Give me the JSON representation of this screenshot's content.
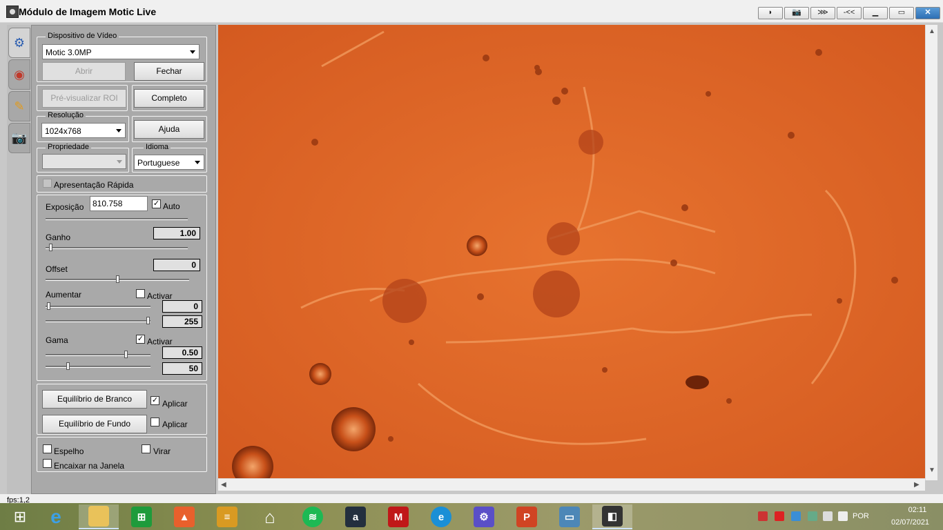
{
  "window": {
    "title": "Módulo de Imagem Motic Live",
    "controls": [
      "play",
      "camera",
      "fish",
      "rewind",
      "minimize",
      "maximize",
      "close"
    ]
  },
  "video_device": {
    "group_label": "Dispositivo de Vídeo",
    "selected": "Motic 3.0MP",
    "open_label": "Abrir",
    "close_label": "Fechar",
    "preview_roi_label": "Pré-visualizar ROI",
    "full_label": "Completo"
  },
  "resolution": {
    "group_label": "Resolução",
    "selected": "1024x768",
    "help_label": "Ajuda"
  },
  "property": {
    "group_label": "Propriedade",
    "selected": ""
  },
  "language": {
    "group_label": "Idioma",
    "selected": "Portuguese"
  },
  "quick_preview": {
    "label": "Apresentação Rápida",
    "checked": false
  },
  "exposure": {
    "label": "Exposição",
    "value": "810.758",
    "auto_label": "Auto",
    "auto_checked": true
  },
  "gain": {
    "label": "Ganho",
    "value": "1.00",
    "level": 0.02
  },
  "offset": {
    "label": "Offset",
    "value": "0",
    "level": 0.5
  },
  "enhance": {
    "label": "Aumentar",
    "activate_label": "Activar",
    "checked": false,
    "low_value": "0",
    "high_value": "255"
  },
  "gamma": {
    "label": "Gama",
    "activate_label": "Activar",
    "checked": true,
    "value1": "0.50",
    "value2": "50"
  },
  "white_balance": {
    "button_label": "Equilíbrio de Branco",
    "apply_label": "Aplicar",
    "checked": true
  },
  "background_balance": {
    "button_label": "Equilíbrio de Fundo",
    "apply_label": "Aplicar",
    "checked": false
  },
  "options": {
    "mirror_label": "Espelho",
    "flip_label": "Virar",
    "fit_label": "Encaixar na Janela"
  },
  "status": {
    "fps": "fps:1,2"
  },
  "taskbar": {
    "apps": [
      "start",
      "internet-explorer",
      "file-explorer",
      "store",
      "photos",
      "notes",
      "home",
      "spotify",
      "amazon",
      "mcafee",
      "edge",
      "settings",
      "powerpoint",
      "photo-viewer",
      "motic"
    ],
    "language": "POR",
    "time": "02:11",
    "date": "02/07/2021"
  },
  "colors": {
    "sample_background": "#e06a2a",
    "panel": "#a9a9a9"
  }
}
